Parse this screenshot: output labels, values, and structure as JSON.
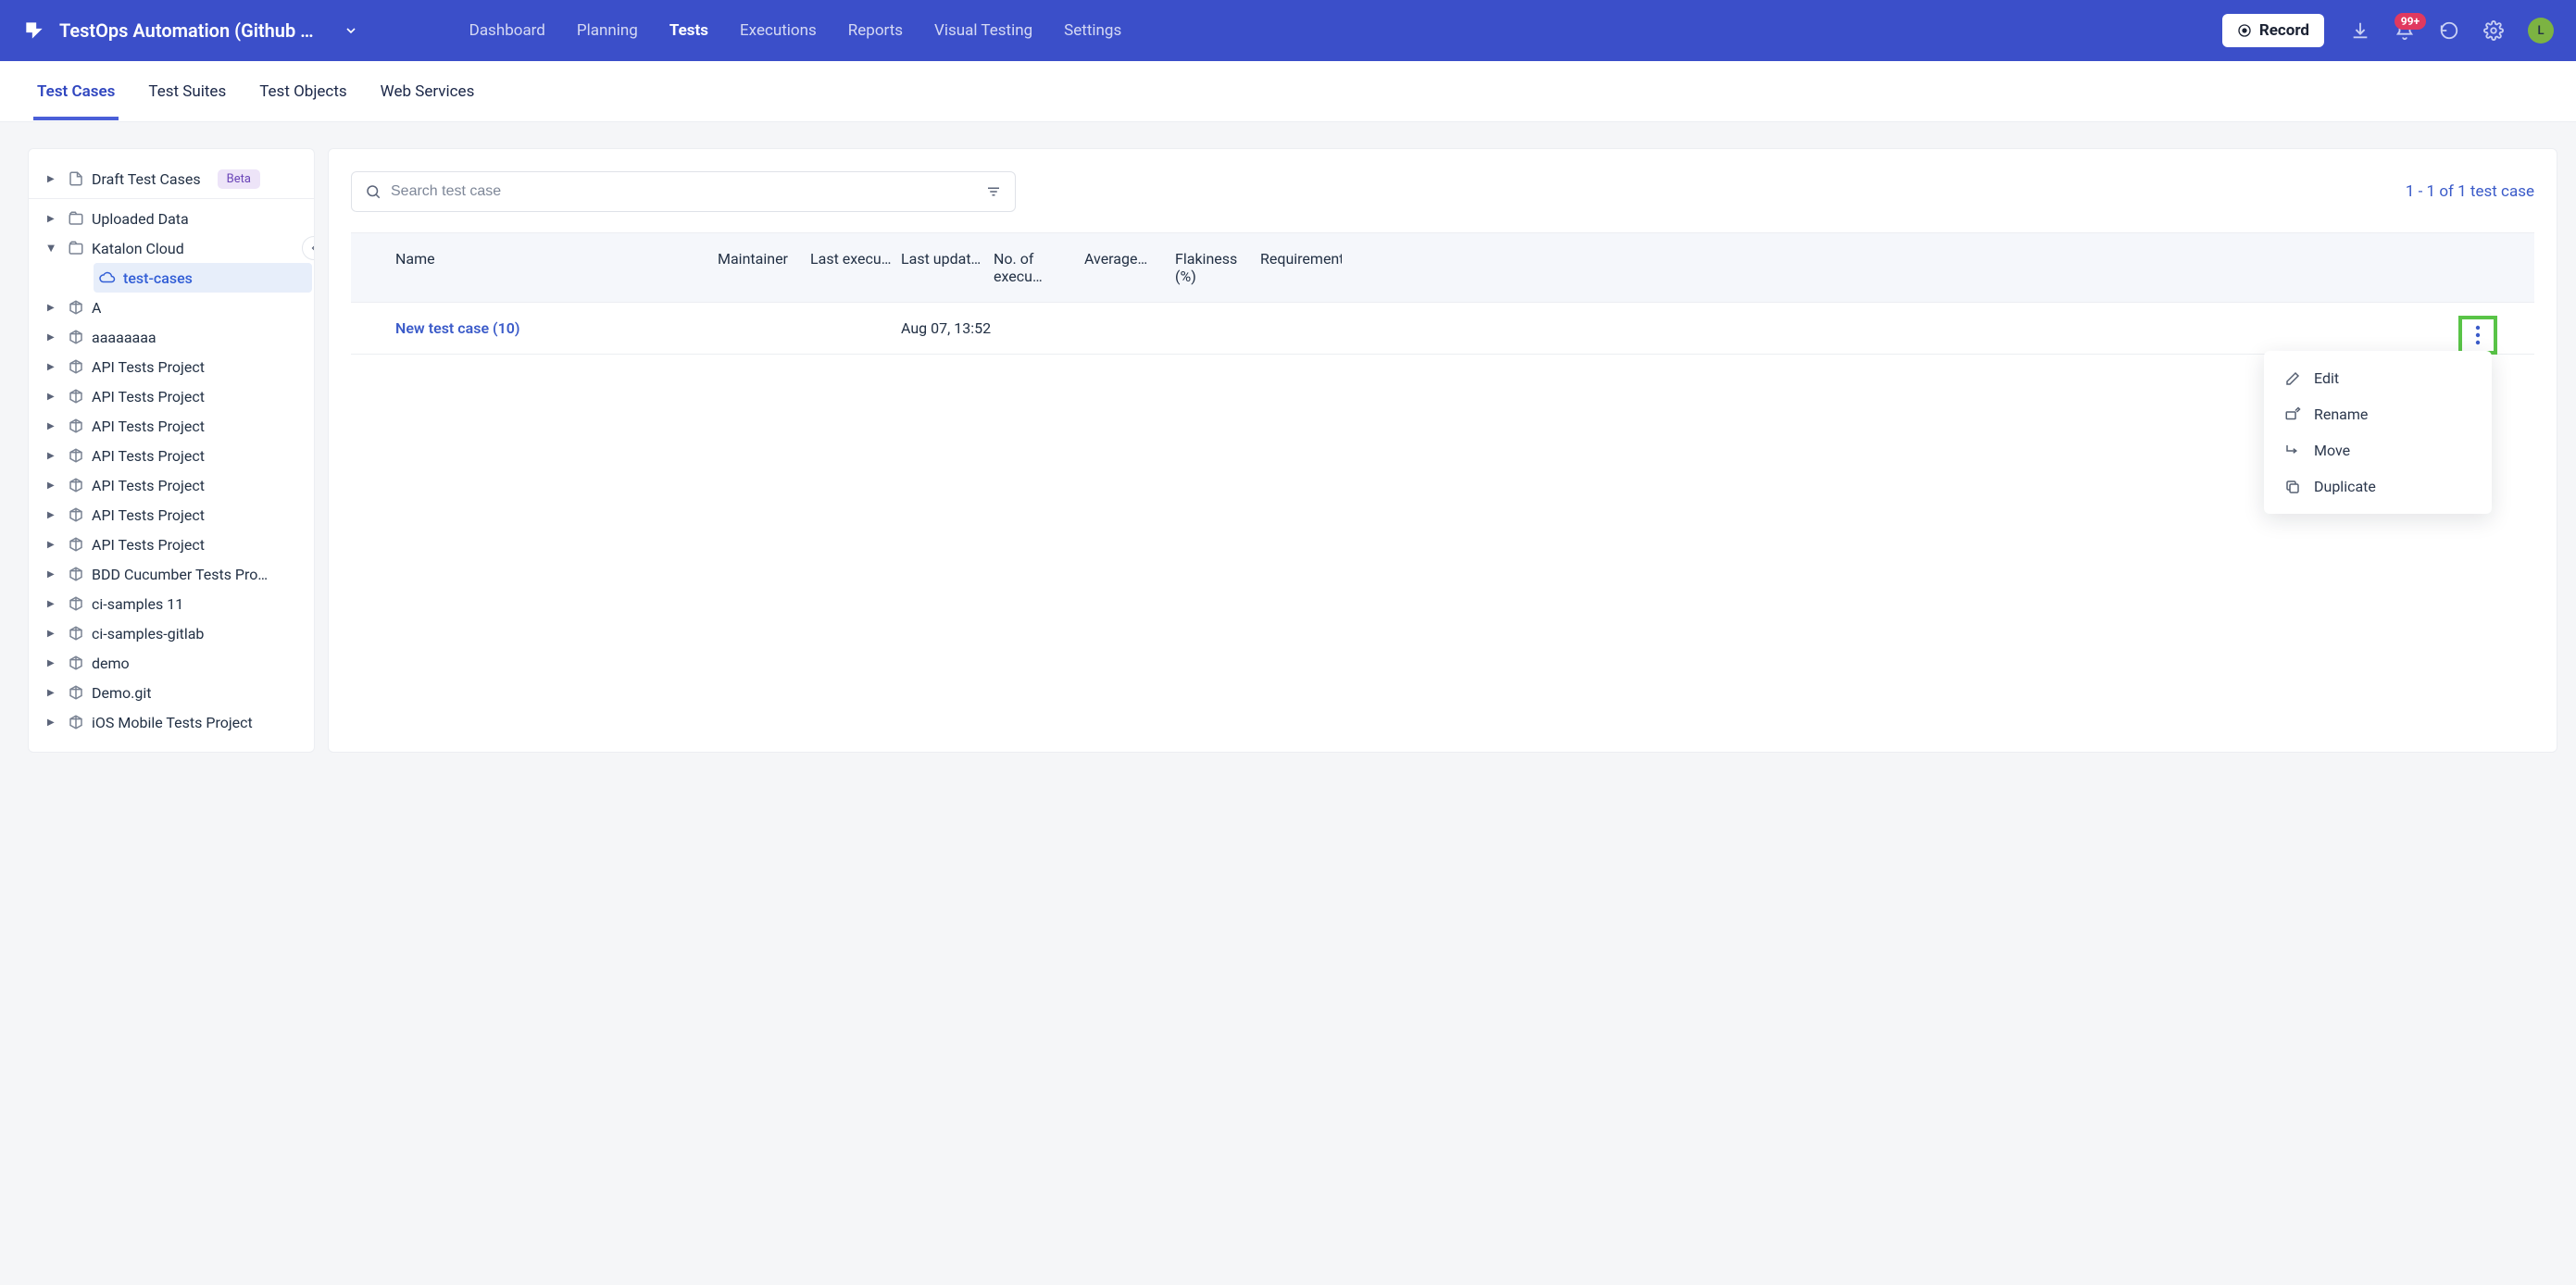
{
  "header": {
    "project_name": "TestOps Automation (Github …",
    "nav": [
      "Dashboard",
      "Planning",
      "Tests",
      "Executions",
      "Reports",
      "Visual Testing",
      "Settings"
    ],
    "nav_active": "Tests",
    "record_label": "Record",
    "notif_badge": "99+",
    "avatar_initial": "L"
  },
  "subtabs": {
    "items": [
      "Test Cases",
      "Test Suites",
      "Test Objects",
      "Web Services"
    ],
    "active": "Test Cases"
  },
  "sidebar": {
    "draft_label": "Draft Test Cases",
    "beta": "Beta",
    "uploaded_label": "Uploaded Data",
    "cloud_label": "Katalon Cloud",
    "selected_label": "test-cases",
    "nodes": [
      "A",
      "aaaaaaaa",
      "API Tests Project",
      "API Tests Project",
      "API Tests Project",
      "API Tests Project",
      "API Tests Project",
      "API Tests Project",
      "API Tests Project",
      "BDD Cucumber Tests Pro…",
      "ci-samples 11",
      "ci-samples-gitlab",
      "demo",
      "Demo.git",
      "iOS Mobile Tests Project"
    ]
  },
  "main": {
    "search_placeholder": "Search test case",
    "results_text": "1 - 1 of 1 test case",
    "columns": {
      "name": "Name",
      "maintainer": "Maintainer",
      "last_exec": "Last execu…",
      "last_updated": "Last updat…",
      "no_exec": "No. of execu…",
      "average": "Average…",
      "flakiness": "Flakiness (%)",
      "requirements": "Requirements"
    },
    "row": {
      "name": "New test case (10)",
      "last_updated": "Aug 07, 13:52"
    },
    "menu": {
      "edit": "Edit",
      "rename": "Rename",
      "move": "Move",
      "duplicate": "Duplicate"
    }
  }
}
